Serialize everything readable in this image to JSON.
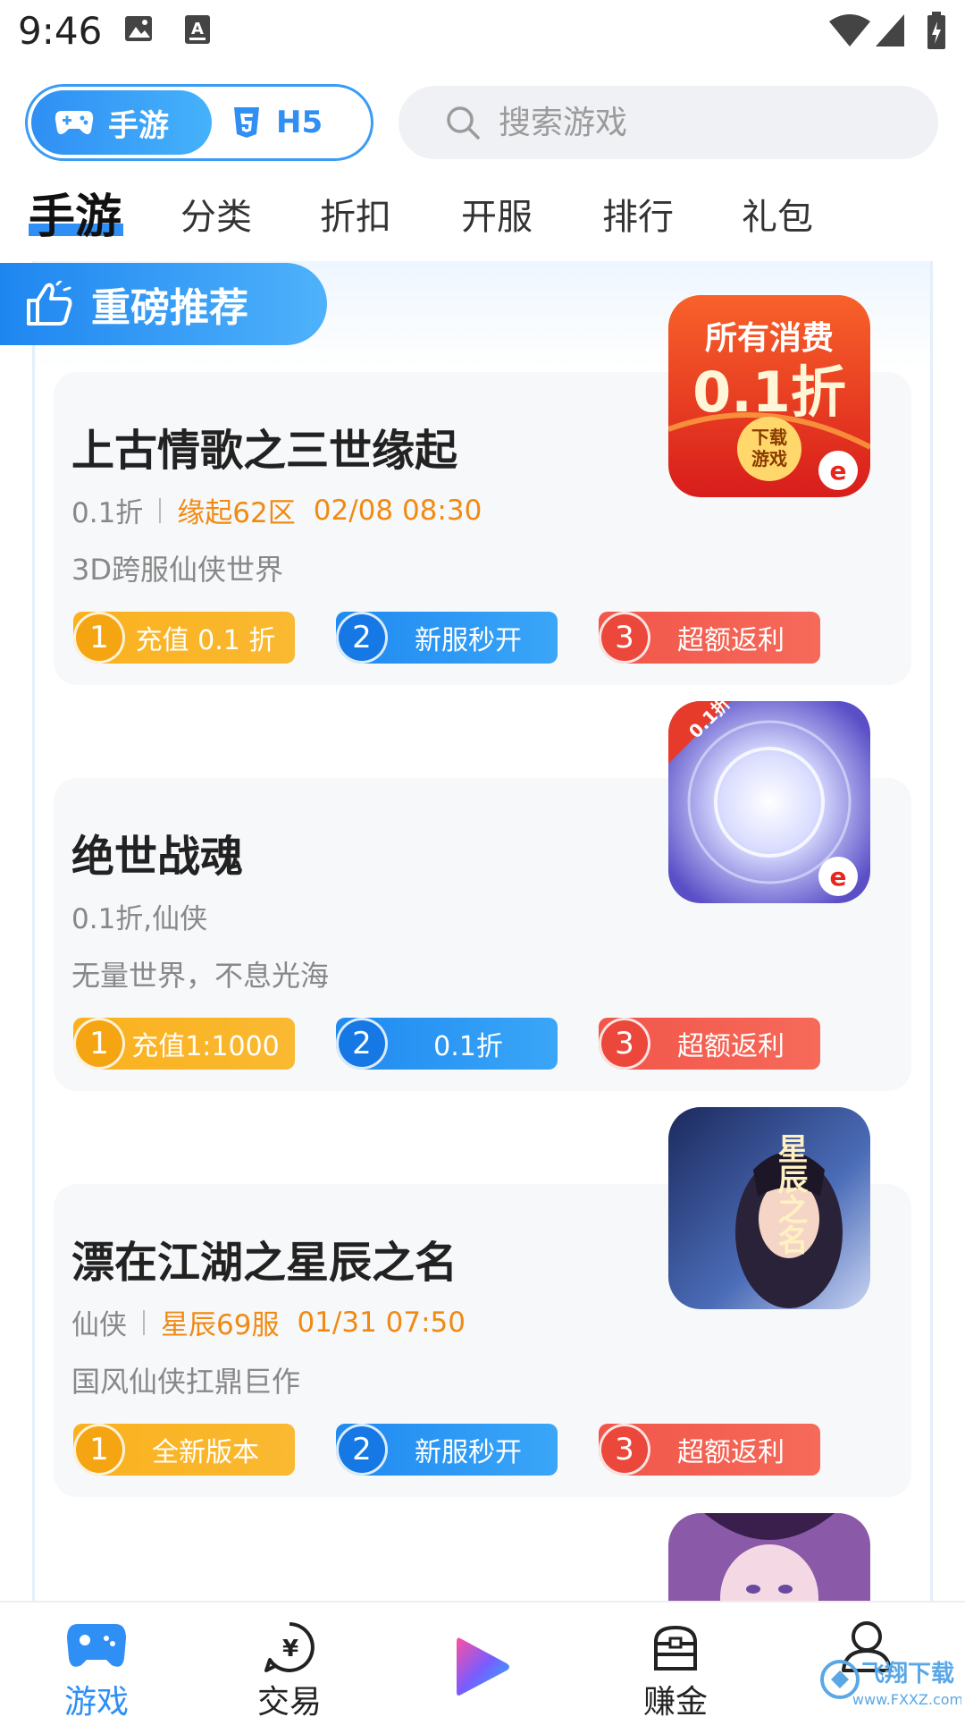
{
  "status_bar": {
    "time": "9:46"
  },
  "mode_switch": {
    "active_label": "手游",
    "other_label": "H5"
  },
  "search": {
    "placeholder": "搜索游戏"
  },
  "tabs": [
    "手游",
    "分类",
    "折扣",
    "开服",
    "排行",
    "礼包"
  ],
  "featured": {
    "title": "重磅推荐"
  },
  "games": [
    {
      "name": "上古情歌之三世缘起",
      "meta_plain": "0.1折",
      "meta_server": "缘起62区",
      "meta_time": "02/08 08:30",
      "description": "3D跨服仙侠世界",
      "icon_text_1": "所有消费",
      "icon_text_2": "0.1折",
      "icon_text_3": "下载",
      "icon_text_4": "游戏",
      "features": [
        {
          "num": "1",
          "label": "充值 0.1 折",
          "color": "orange"
        },
        {
          "num": "2",
          "label": "新服秒开",
          "color": "blue"
        },
        {
          "num": "3",
          "label": "超额返利",
          "color": "red"
        }
      ]
    },
    {
      "name": "绝世战魂",
      "meta_plain": "0.1折,仙侠",
      "description": "无量世界，不息光海",
      "icon_badge": "0.1折",
      "features": [
        {
          "num": "1",
          "label": "充值1:1000",
          "color": "orange"
        },
        {
          "num": "2",
          "label": "0.1折",
          "color": "blue"
        },
        {
          "num": "3",
          "label": "超额返利",
          "color": "red"
        }
      ]
    },
    {
      "name": "漂在江湖之星辰之名",
      "meta_plain": "仙侠",
      "meta_server": "星辰69服",
      "meta_time": "01/31 07:50",
      "description": "国风仙侠扛鼎巨作",
      "icon_title": "星辰之名",
      "features": [
        {
          "num": "1",
          "label": "全新版本",
          "color": "orange"
        },
        {
          "num": "2",
          "label": "新服秒开",
          "color": "blue"
        },
        {
          "num": "3",
          "label": "超额返利",
          "color": "red"
        }
      ]
    }
  ],
  "bottom_nav": {
    "games": "游戏",
    "trade": "交易",
    "earn": "赚金"
  },
  "watermark": {
    "text": "飞翔下载",
    "url_text": "www.FXXZ.com"
  },
  "colors": {
    "accent": "#2f8ff4",
    "orange": "#f08a13",
    "pill_orange": "#fbb11e",
    "pill_blue": "#1f8af0",
    "pill_red": "#f1564a"
  }
}
